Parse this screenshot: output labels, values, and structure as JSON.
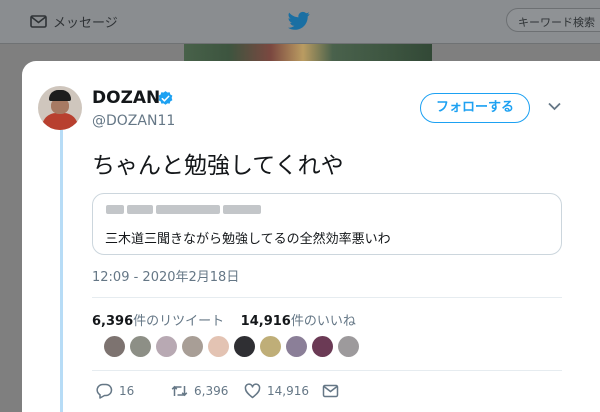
{
  "nav": {
    "messages_label": "メッセージ",
    "search_placeholder": "キーワード検索"
  },
  "tweet": {
    "display_name": "DOZAN",
    "handle": "@DOZAN11",
    "follow_label": "フォローする",
    "text": "ちゃんと勉強してくれや",
    "quoted_text": "三木道三聞きながら勉強してるの全然効率悪いわ",
    "timestamp": "12:09 - 2020年2月18日",
    "retweets_count": "6,396",
    "retweets_label": "件のリツイート",
    "likes_count": "14,916",
    "likes_label": "件のいいね",
    "actions": {
      "reply_count": "16",
      "retweet_count": "6,396",
      "like_count": "14,916"
    }
  },
  "colors": {
    "accent": "#1da1f2",
    "thread_line": "#b7dcf6",
    "muted_text": "#657786"
  },
  "icons": [
    "mail-icon",
    "twitter-bird-icon",
    "verified-icon",
    "chevron-down-icon",
    "reply-icon",
    "retweet-icon",
    "like-icon",
    "dm-icon"
  ]
}
